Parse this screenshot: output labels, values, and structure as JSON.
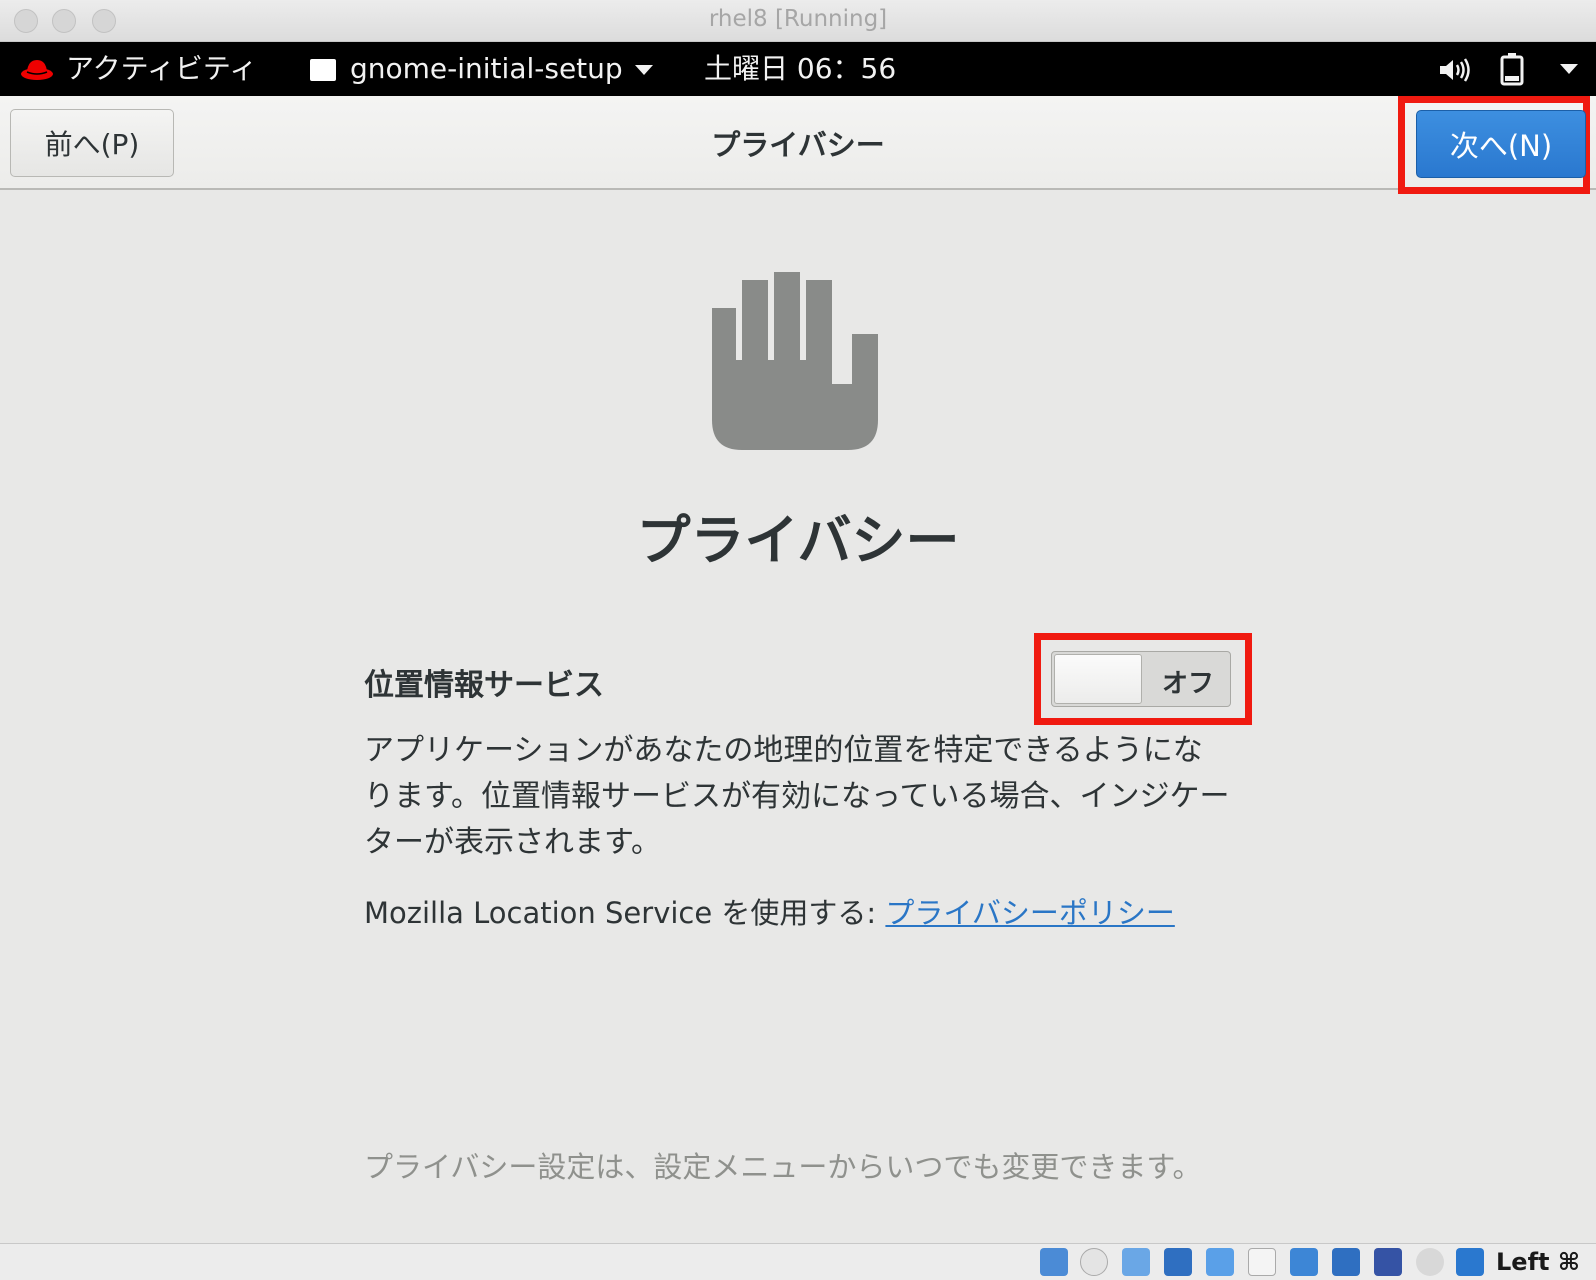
{
  "window": {
    "title": "rhel8 [Running]"
  },
  "topbar": {
    "activities": "アクティビティ",
    "app_name": "gnome-initial-setup",
    "clock": "土曜日 06：56"
  },
  "header": {
    "back_label": "前へ(P)",
    "title": "プライバシー",
    "next_label": "次へ(N)"
  },
  "page": {
    "title": "プライバシー",
    "location": {
      "label": "位置情報サービス",
      "toggle_state": "オフ",
      "description_lines": [
        "アプリケーションがあなたの地理的位置を特定できるようにな",
        "ります。位置情報サービスが有効になっている場合、インジケー",
        "ターが表示されます。"
      ]
    },
    "policy_prefix": "Mozilla Location Service を使用する: ",
    "policy_link": "プライバシーポリシー",
    "footer_note": "プライバシー設定は、設定メニューからいつでも変更できます。"
  },
  "statusbar": {
    "host_key": "Left ⌘"
  },
  "colors": {
    "accent": "#2a78cf",
    "highlight": "#f01a10",
    "link": "#2a76c6"
  }
}
